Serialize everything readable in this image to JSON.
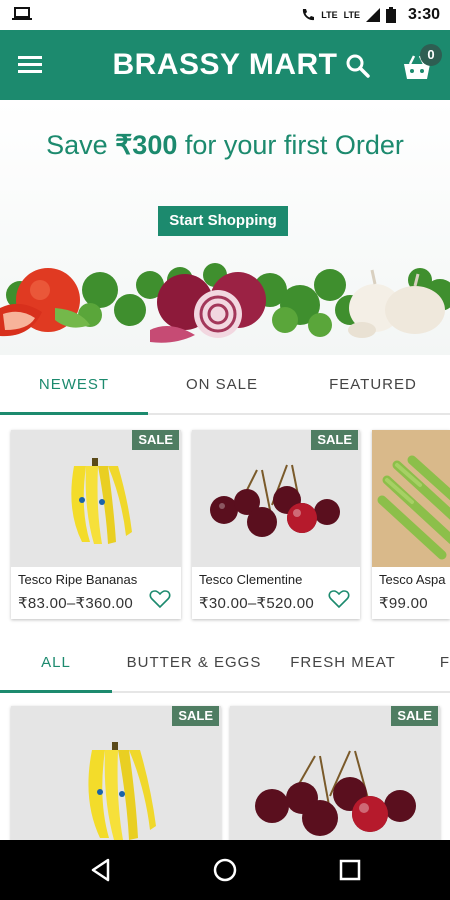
{
  "status_bar": {
    "network_1": "LTE",
    "network_2": "LTE",
    "time": "3:30",
    "icons": [
      "laptop-icon",
      "phone-call-icon",
      "signal-icon",
      "battery-icon"
    ]
  },
  "app_bar": {
    "title": "BRASSY MART",
    "cart_count": "0",
    "icons": [
      "menu-icon",
      "search-icon",
      "cart-icon"
    ],
    "color": "#1c8a6e"
  },
  "banner": {
    "headline_prefix": "Save ",
    "headline_amount": "₹300",
    "headline_suffix": " for your first Order",
    "cta_label": "Start Shopping"
  },
  "tabs_primary": {
    "items": [
      {
        "label": "NEWEST",
        "active": true
      },
      {
        "label": "ON SALE",
        "active": false
      },
      {
        "label": "FEATURED",
        "active": false
      }
    ]
  },
  "products_row": [
    {
      "badge": "SALE",
      "name": "Tesco Ripe Bananas",
      "price": "₹83.00–₹360.00",
      "image": "bananas"
    },
    {
      "badge": "SALE",
      "name": "Tesco Clementine",
      "price": "₹30.00–₹520.00",
      "image": "cherries"
    },
    {
      "badge": "",
      "name": "Tesco Aspa",
      "price": "₹99.00",
      "image": "asparagus"
    }
  ],
  "tabs_categories": {
    "items": [
      {
        "label": "ALL",
        "active": true
      },
      {
        "label": "BUTTER & EGGS",
        "active": false
      },
      {
        "label": "FRESH MEAT",
        "active": false
      },
      {
        "label": "F",
        "active": false
      }
    ]
  },
  "products_grid": [
    {
      "badge": "SALE",
      "image": "bananas"
    },
    {
      "badge": "SALE",
      "image": "cherries"
    }
  ],
  "nav_bar": {
    "icons": [
      "back-icon",
      "home-icon",
      "recents-icon"
    ]
  }
}
